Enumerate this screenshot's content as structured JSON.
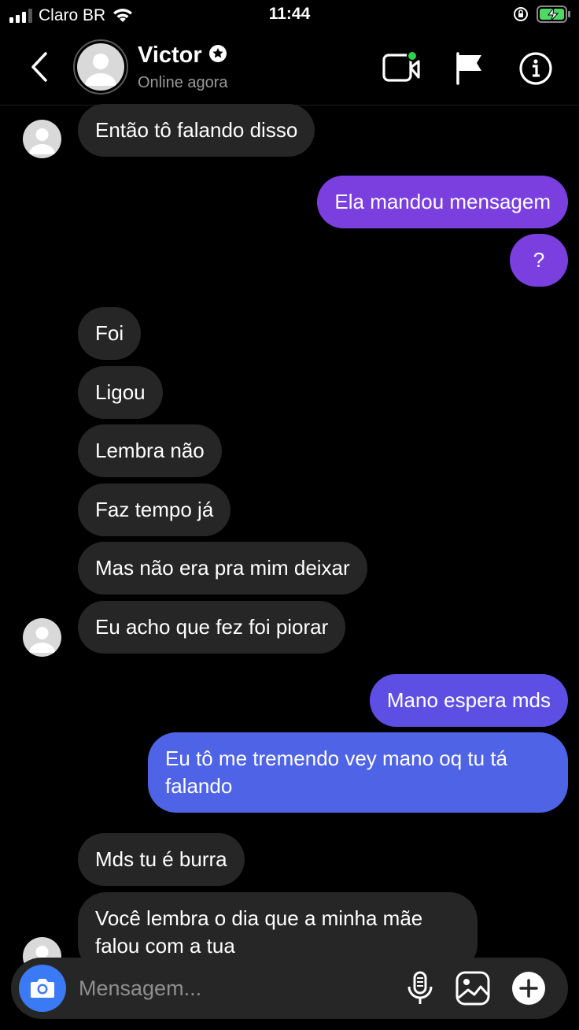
{
  "status_bar": {
    "carrier": "Claro BR",
    "time": "11:44"
  },
  "header": {
    "contact_name": "Victor",
    "contact_status": "Online agora"
  },
  "messages": [
    {
      "sender": "them",
      "text": "Então tô falando disso"
    },
    {
      "sender": "me",
      "text": "Ela mandou mensagem"
    },
    {
      "sender": "me",
      "text": "?"
    },
    {
      "sender": "them",
      "text": "Foi"
    },
    {
      "sender": "them",
      "text": "Ligou"
    },
    {
      "sender": "them",
      "text": "Lembra não"
    },
    {
      "sender": "them",
      "text": "Faz tempo já"
    },
    {
      "sender": "them",
      "text": "Mas não era pra mim deixar"
    },
    {
      "sender": "them",
      "text": "Eu acho que fez foi piorar"
    },
    {
      "sender": "me",
      "text": "Mano espera mds"
    },
    {
      "sender": "me",
      "text": "Eu tô me tremendo vey mano oq tu tá falando"
    },
    {
      "sender": "them",
      "text": "Mds tu é burra"
    },
    {
      "sender": "them",
      "text": "Você lembra o dia que a minha mãe falou com a tua"
    }
  ],
  "composer": {
    "placeholder": "Mensagem..."
  },
  "colors": {
    "incoming_bubble": "#262626",
    "outgoing_purple": "#7b3fe0",
    "outgoing_blue": "#4f63e6",
    "camera_button": "#3a7af5",
    "online_dot": "#2fd14a",
    "battery_charge": "#4cd964"
  },
  "icons": [
    "back-chevron-icon",
    "verified-badge-icon",
    "video-call-icon",
    "flag-icon",
    "info-icon",
    "camera-icon",
    "microphone-icon",
    "gallery-icon",
    "plus-icon",
    "wifi-icon",
    "orientation-lock-icon",
    "battery-charging-icon"
  ]
}
